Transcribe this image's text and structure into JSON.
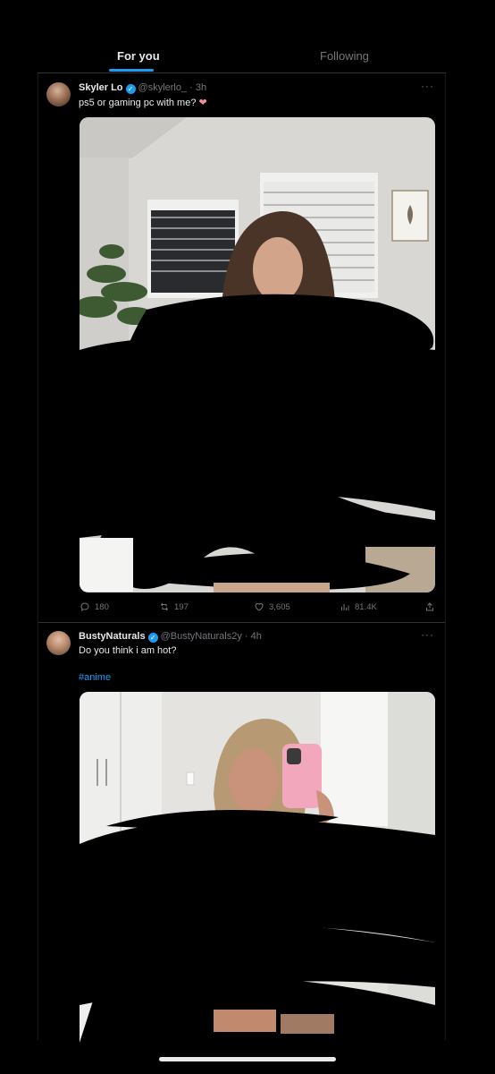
{
  "tabs": {
    "for_you": "For you",
    "following": "Following"
  },
  "tweets": [
    {
      "name": "Skyler Lo",
      "handle": "@skylerlo_",
      "separator": "·",
      "time": "3h",
      "text": "ps5 or gaming pc with me?",
      "emoji": "❤",
      "more": "···",
      "replies": "180",
      "retweets": "197",
      "likes": "3,605",
      "views": "81.4K"
    },
    {
      "name": "BustyNaturals",
      "handle": "@BustyNaturals2y",
      "separator": "·",
      "time": "4h",
      "text": "Do you think i am hot?",
      "hashtag": "#anime",
      "more": "···"
    }
  ],
  "colors": {
    "accent": "#1d9bf0",
    "background": "#000000",
    "muted": "#71767b"
  },
  "icons": [
    "reply-icon",
    "retweet-icon",
    "like-icon",
    "views-icon",
    "share-icon",
    "verified-icon",
    "more-icon"
  ]
}
